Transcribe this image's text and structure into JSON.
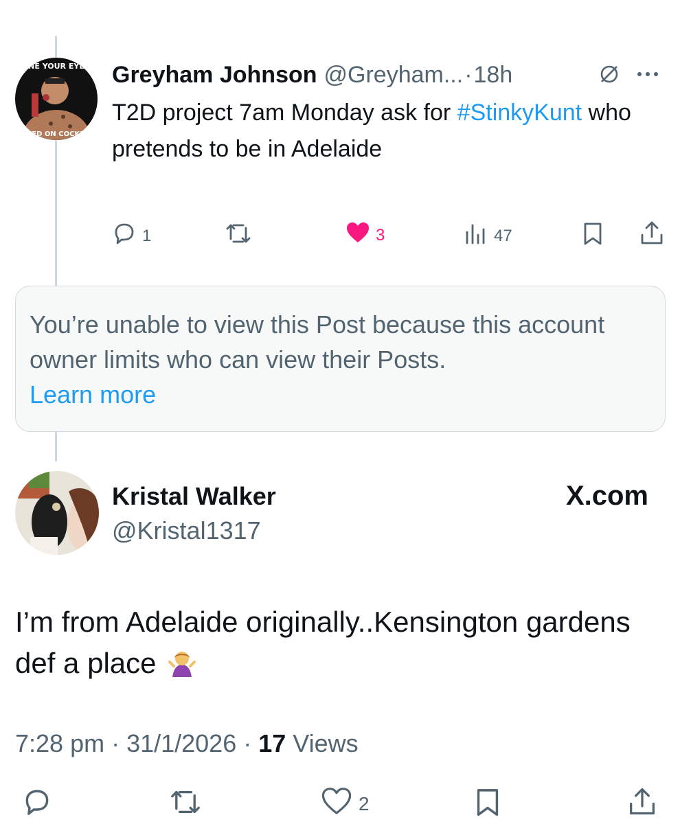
{
  "original_post": {
    "author_name": "Greyham Johnson",
    "author_handle": "@Greyham...",
    "separator": "·",
    "time_ago": "18h",
    "text_before": "T2D project 7am Monday ask for ",
    "hashtag": "#StinkyKunt",
    "text_after": " who pretends to be in Adelaide",
    "avatar_caption_top": "NE YOUR EYE",
    "avatar_caption_bottom": "TED ON COCKN",
    "actions": {
      "replies": "1",
      "likes": "3",
      "views": "47"
    },
    "like_color": "#f91880"
  },
  "unavailable_notice": {
    "text": "You’re unable to view this Post because this account owner limits who can view their Posts.",
    "link": "Learn more"
  },
  "reply_post": {
    "author_name": "Kristal Walker",
    "author_handle": "@Kristal1317",
    "site_label": "X.com",
    "text": "I’m from Adelaide originally..Kensington gardens def a place",
    "emoji": "person-shrugging-icon",
    "timestamp": "7:28 pm · 31/1/2026 · ",
    "views_count": "17",
    "views_label": " Views",
    "actions": {
      "likes": "2"
    }
  },
  "colors": {
    "link_blue": "#1d9bf0",
    "secondary_text": "#536471",
    "primary_text": "#0f1419",
    "border": "#cfd9de"
  }
}
